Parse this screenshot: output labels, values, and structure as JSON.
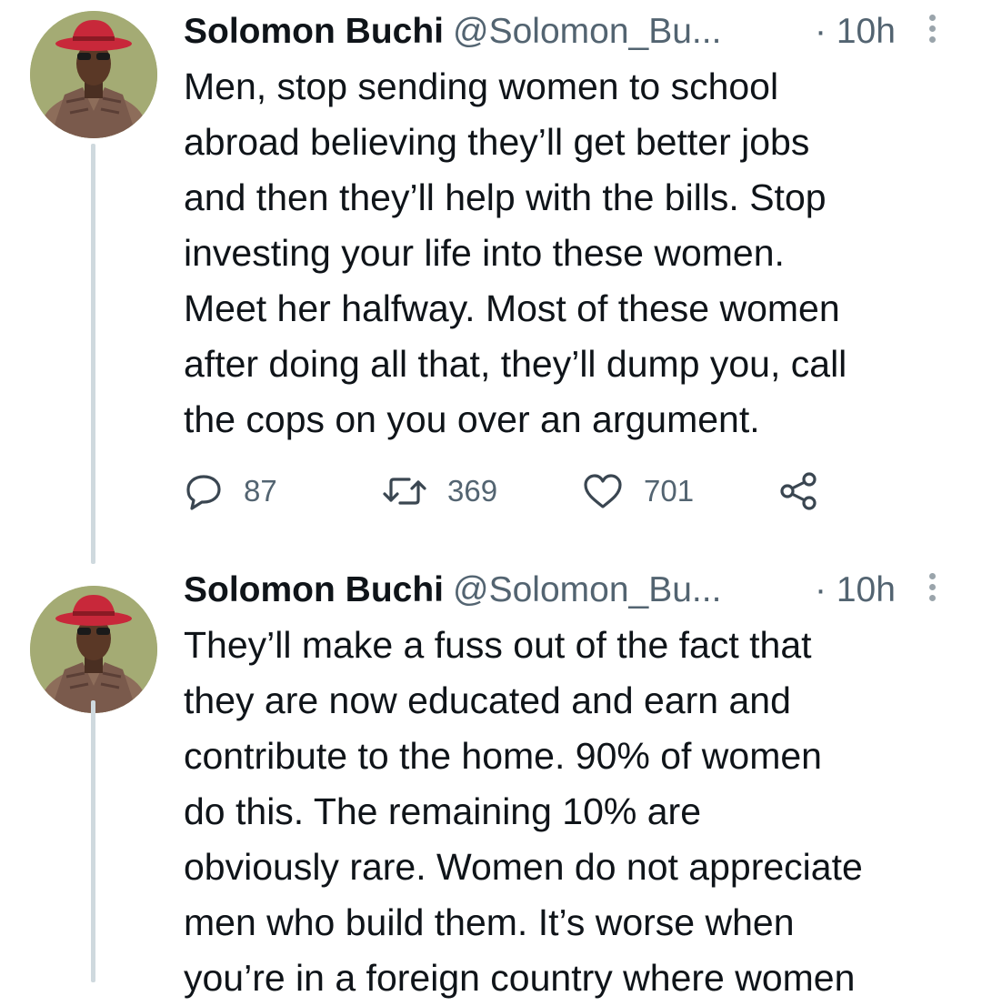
{
  "tweets": [
    {
      "author_name": "Solomon Buchi",
      "handle": "@Solomon_Bu...",
      "time": "· 10h",
      "text": "Men, stop sending women to school\nabroad believing they’ll get better jobs\nand then they’ll help with the bills. Stop\ninvesting your life into these women.\nMeet her halfway. Most of these women\nafter doing all that, they’ll dump you, call\nthe cops on you over an argument.",
      "replies": "87",
      "retweets": "369",
      "likes": "701"
    },
    {
      "author_name": "Solomon Buchi",
      "handle": "@Solomon_Bu...",
      "time": "· 10h",
      "text": "They’ll make a fuss out of the fact that\nthey are now educated and earn and\ncontribute to the home. 90% of women\ndo this.  The remaining 10% are\nobviously rare. Women do not appreciate\nmen who build them. It’s worse when\nyou’re in a foreign country where women"
    }
  ],
  "icons": {
    "reply": "speech-bubble-icon",
    "retweet": "retweet-arrows-icon",
    "like": "heart-icon",
    "share": "share-nodes-icon",
    "more": "vertical-dots-icon"
  },
  "colors": {
    "text": "#0f1419",
    "secondary": "#536471",
    "thread_line": "#cfd9de",
    "hat": "#c8283a"
  }
}
